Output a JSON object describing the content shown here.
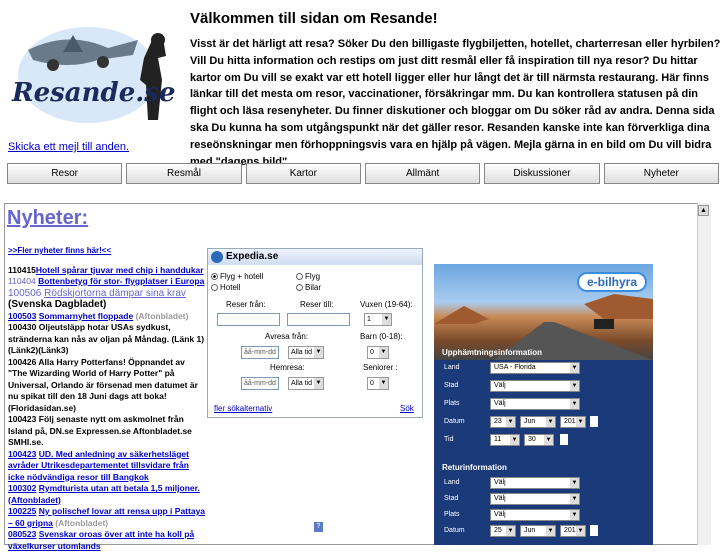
{
  "header": {
    "title": "Välkommen till sidan om Resande!",
    "logo_text": "Resande.se",
    "intro": "Visst är det härligt att resa? Söker Du den billigaste flygbiljetten, hotellet, charterresan eller hyrbilen? Vill Du hitta information och restips om just ditt resmål eller få inspiration till nya resor? Du hittar kartor om Du vill se exakt var ett hotell ligger eller hur långt det är till närmsta restaurang. Här finns länkar till det mesta om resor, vaccinationer, försäkringar mm. Du kan kontrollera statusen på din flight och läsa resenyheter.  Du finner diskutioner och bloggar om Du söker råd av andra. Denna sida ska Du kunna ha som utgångspunkt när det gäller resor. Resanden kanske inte kan förverkliga dina reseönskningar men förhoppningsvis vara en hjälp på vägen. Mejla gärna in en bild om Du vill bidra med \"dagens bild\".",
    "mail_link": "Skicka ett mejl till anden."
  },
  "nav": [
    "Resor",
    "Resmål",
    "Kartor",
    "Allmänt",
    "Diskussioner",
    "Nyheter"
  ],
  "news": {
    "title": "Nyheter:",
    "more": ">>Fler nyheter finns här!<<",
    "items": [
      {
        "date": "110415",
        "text": "Hotell spårar tjuvar med chip i handdukar",
        "link": true
      },
      {
        "date": "110404",
        "text": "Bottenbetyg för stor- flygplatser i Europa",
        "link": true
      },
      {
        "date": "100506",
        "text": "Rödskjortorna dämpar sina krav",
        "tail": " (Svenska Dagbladet)",
        "big": true
      },
      {
        "date": "100503",
        "text": "Sommarnyhet floppade",
        "tail": " (Aftonbladet)",
        "link": true
      },
      {
        "date": "100430",
        "text": "Oljeutsläpp hotar USAs sydkust, stränderna kan nås av oljan på Måndag. (Länk 1)(Länk2)(Länk3)"
      },
      {
        "date": "100426",
        "text": "Alla Harry Potterfans! Öppnandet av \"The Wizarding World of Harry Potter\" på Universal, Orlando är försenad men datumet är nu spikat till den 18 Juni dags att boka! (Floridasidan.se)"
      },
      {
        "date": "100423",
        "text": "Följ senaste nytt om askmolnet från Island på, DN.se Expressen.se Aftonbladet.se SMHI.se."
      },
      {
        "date": "100423",
        "text": "UD. Med anledning av säkerhetsläget avråder Utrikesdepartementet tillsvidare från icke nödvändiga resor till Bangkok",
        "link": true
      },
      {
        "date": "100302",
        "text": "Rymdturista utan att betala 1,5 miljoner. (Aftonbladet)",
        "link": true
      },
      {
        "date": "100225",
        "text": "Ny polischef lovar att rensa upp i Pattaya – 60 gripna",
        "tail": " (Aftonbladet)",
        "link": true
      },
      {
        "date": "080523",
        "text": "Svenskar oroas över att inte ha koll på växelkurser utomlands",
        "link": true
      }
    ]
  },
  "expedia": {
    "brand": "Expedia.se",
    "radio1": "Flyg + hotell",
    "radio2": "Flyg",
    "radio3": "Hotell",
    "radio4": "Bilar",
    "from_label": "Reser från:",
    "to_label": "Reser till:",
    "adults_label": "Vuxen (19-64):",
    "depart_label": "Avresa från:",
    "children_label": "Barn (0-18):",
    "return_label": "Hemresa:",
    "seniors_label": "Seniorer :",
    "date_placeholder": "åå-mm-dd",
    "time_value": "Alla tid",
    "adults_value": "1",
    "children_value": "0",
    "seniors_value": "0",
    "more_options": "fler sökalternativ",
    "search": "Sök"
  },
  "bilhyra": {
    "brand": "e-bilhyra",
    "pickup_title": "Upphämtningsinformation",
    "return_title": "Returinformation",
    "land_label": "Land",
    "stad_label": "Stad",
    "plats_label": "Plats",
    "datum_label": "Datum",
    "tid_label": "Tid",
    "land_value": "USA - Florida",
    "choose": "Välj",
    "day": "23",
    "day2": "25",
    "month": "Jun",
    "year": "201",
    "hour": "11",
    "minute": "30"
  },
  "colors": {
    "news_title": "#6666cc",
    "link": "#0000cc",
    "bilhyra_bg": "#1b3a7a"
  }
}
